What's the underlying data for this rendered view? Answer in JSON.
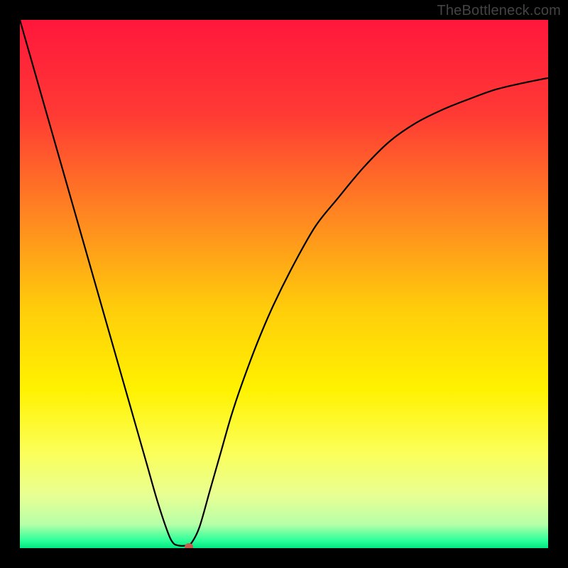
{
  "attribution": "TheBottleneck.com",
  "chart_data": {
    "type": "line",
    "title": "",
    "xlabel": "",
    "ylabel": "",
    "xlim": [
      0,
      100
    ],
    "ylim": [
      0,
      100
    ],
    "background_gradient": [
      {
        "pos": 0.0,
        "color": "#ff173c"
      },
      {
        "pos": 0.18,
        "color": "#ff3a34"
      },
      {
        "pos": 0.38,
        "color": "#ff8a20"
      },
      {
        "pos": 0.55,
        "color": "#ffce0a"
      },
      {
        "pos": 0.7,
        "color": "#fff200"
      },
      {
        "pos": 0.82,
        "color": "#fbff5a"
      },
      {
        "pos": 0.9,
        "color": "#e8ff93"
      },
      {
        "pos": 0.955,
        "color": "#b7ffa8"
      },
      {
        "pos": 0.985,
        "color": "#2fff9a"
      },
      {
        "pos": 1.0,
        "color": "#00e884"
      }
    ],
    "series": [
      {
        "name": "bottleneck-curve",
        "x": [
          0.0,
          2,
          4,
          6,
          8,
          10,
          12,
          14,
          16,
          18,
          20,
          22,
          24,
          26,
          28,
          29,
          30,
          31.5,
          32.5,
          34,
          36,
          38,
          40,
          42,
          45,
          48,
          52,
          56,
          60,
          65,
          70,
          75,
          80,
          85,
          90,
          95,
          100
        ],
        "y": [
          100,
          93,
          86,
          79,
          72,
          65,
          58,
          51,
          44,
          37,
          30,
          23,
          16,
          9,
          3,
          1,
          0.5,
          0.5,
          1,
          4,
          11,
          18,
          25,
          31,
          39,
          46,
          54,
          61,
          66,
          72,
          77,
          80.5,
          83,
          85,
          86.8,
          88,
          89
        ],
        "color": "#000000",
        "width": 2.2
      }
    ],
    "marker": {
      "name": "optimal-point",
      "x": 32,
      "y": 0,
      "rx": 6,
      "ry": 5,
      "color": "#c95a4e"
    }
  }
}
